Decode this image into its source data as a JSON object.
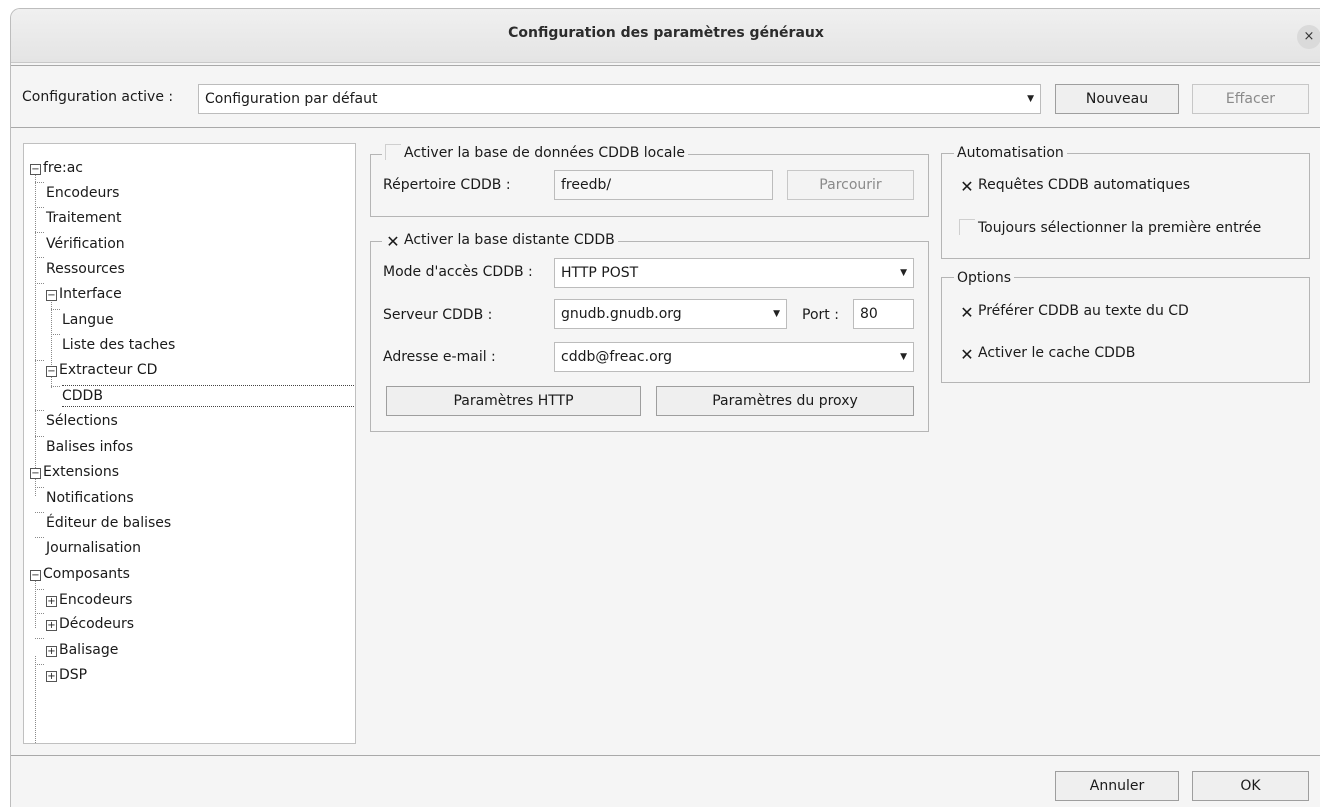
{
  "window": {
    "title": "Configuration des paramètres généraux",
    "close_glyph": "×"
  },
  "config": {
    "label": "Configuration active :",
    "value": "Configuration par défaut",
    "new_button": "Nouveau",
    "delete_button": "Effacer"
  },
  "tree": {
    "root": "fre:ac",
    "encoders": "Encodeurs",
    "processing": "Traitement",
    "verification": "Vérification",
    "resources": "Ressources",
    "interface": "Interface",
    "language": "Langue",
    "tasklist": "Liste des taches",
    "cd_ripper": "Extracteur CD",
    "cddb": "CDDB",
    "selections": "Sélections",
    "tags": "Balises infos",
    "extensions": "Extensions",
    "notifications": "Notifications",
    "tag_editor": "Éditeur de balises",
    "logging": "Journalisation",
    "components": "Composants",
    "comp_encoders": "Encodeurs",
    "comp_decoders": "Décodeurs",
    "comp_tagging": "Balisage",
    "comp_dsp": "DSP",
    "expander_open": "−",
    "expander_closed": "+"
  },
  "local_cddb": {
    "title": "Activer la base de données CDDB locale",
    "checked": false,
    "dir_label": "Répertoire CDDB :",
    "dir_value": "freedb/",
    "browse_button": "Parcourir"
  },
  "remote_cddb": {
    "title": "Activer la base distante CDDB",
    "checked": true,
    "mode_label": "Mode d'accès CDDB :",
    "mode_value": "HTTP POST",
    "server_label": "Serveur CDDB :",
    "server_value": "gnudb.gnudb.org",
    "port_label": "Port :",
    "port_value": "80",
    "email_label": "Adresse e-mail :",
    "email_value": "cddb@freac.org",
    "http_button": "Paramètres HTTP",
    "proxy_button": "Paramètres du proxy"
  },
  "automation": {
    "title": "Automatisation",
    "auto_queries": "Requêtes CDDB automatiques",
    "auto_queries_checked": true,
    "always_first": "Toujours sélectionner la première entrée",
    "always_first_checked": false
  },
  "options": {
    "title": "Options",
    "prefer_cddb": "Préférer CDDB au texte du CD",
    "prefer_cddb_checked": true,
    "enable_cache": "Activer le cache CDDB",
    "enable_cache_checked": true
  },
  "footer": {
    "cancel_button": "Annuler",
    "ok_button": "OK"
  },
  "glyphs": {
    "check": "✕",
    "dropdown": "▼"
  }
}
